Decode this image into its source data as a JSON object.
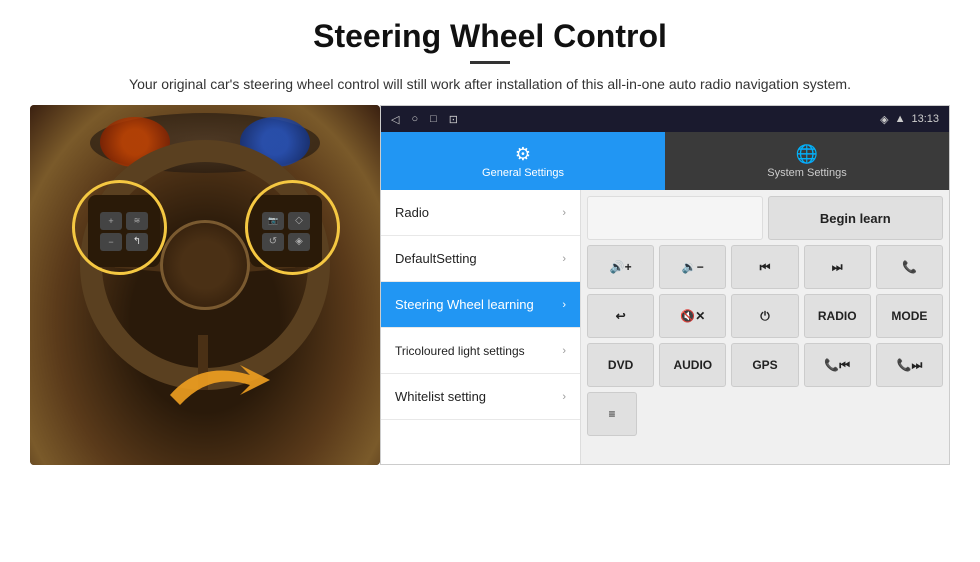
{
  "header": {
    "title": "Steering Wheel Control",
    "description": "Your original car's steering wheel control will still work after installation of this all-in-one auto radio navigation system."
  },
  "status_bar": {
    "time": "13:13",
    "icons": [
      "◁",
      "○",
      "□",
      "⊡"
    ]
  },
  "tabs": [
    {
      "id": "general",
      "label": "General Settings",
      "icon": "⚙",
      "active": true
    },
    {
      "id": "system",
      "label": "System Settings",
      "icon": "🌐",
      "active": false
    }
  ],
  "menu_items": [
    {
      "id": "radio",
      "label": "Radio",
      "active": false
    },
    {
      "id": "default",
      "label": "DefaultSetting",
      "active": false
    },
    {
      "id": "steering",
      "label": "Steering Wheel learning",
      "active": true
    },
    {
      "id": "tricolour",
      "label": "Tricoloured light settings",
      "active": false
    },
    {
      "id": "whitelist",
      "label": "Whitelist setting",
      "active": false
    }
  ],
  "controls": {
    "begin_learn": "Begin learn",
    "buttons": [
      [
        "vol+",
        "vol-",
        "prev",
        "next",
        "phone"
      ],
      [
        "hangup",
        "mute",
        "power",
        "RADIO",
        "MODE"
      ],
      [
        "DVD",
        "AUDIO",
        "GPS",
        "tel+prev",
        "tel+next"
      ]
    ],
    "special": "≡"
  }
}
